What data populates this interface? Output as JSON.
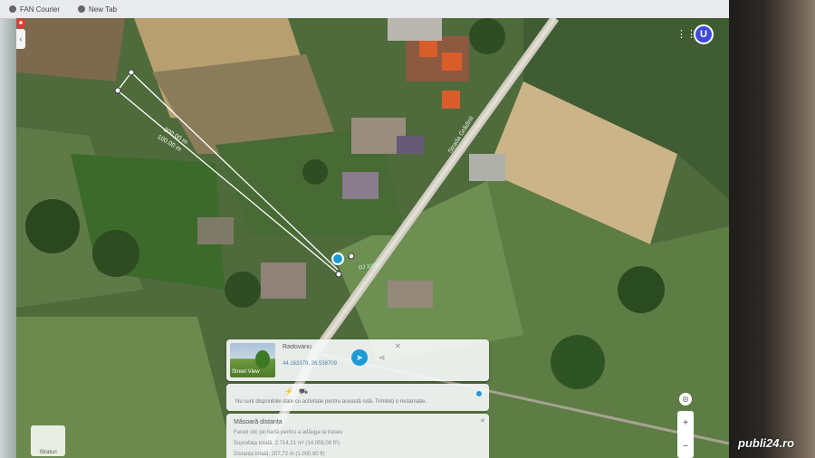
{
  "browser": {
    "tabs": [
      {
        "label": "FAN Courier",
        "icon": "courier-icon"
      },
      {
        "label": "New Tab",
        "icon": "globe-icon"
      }
    ]
  },
  "map": {
    "avatar_letter": "U",
    "measure_distances": [
      "200.00 m",
      "100.00 m"
    ],
    "street_label": "Strada Grădinii",
    "road_label": "DJ 102G",
    "colors": {
      "accent": "#1a9bd7",
      "avatar": "#3e4bd8",
      "measure_line": "#ffffff",
      "pin": "#e03a3a"
    }
  },
  "info_card": {
    "place": "Radovanu",
    "coords": "44.163379, 26.538709",
    "photo_caption": "Street View"
  },
  "tools_card": {
    "msg": "Nu sunt disponibile date cu activitate pentru această rută. Trimiteți o reclamație."
  },
  "measure_card": {
    "title": "Măsoară distanța",
    "desc": "Faceți clic pe hartă pentru a adăuga la traseu",
    "line1": "Suprafața totală: 2.714,21 m² (14.059,08 ft²)",
    "line2": "Distanța totală: 207,72 m (1.000,90 ft)"
  },
  "controls": {
    "zoom_in": "+",
    "zoom_out": "−",
    "layers_label": "Straturi"
  },
  "watermark": "publi24.ro"
}
